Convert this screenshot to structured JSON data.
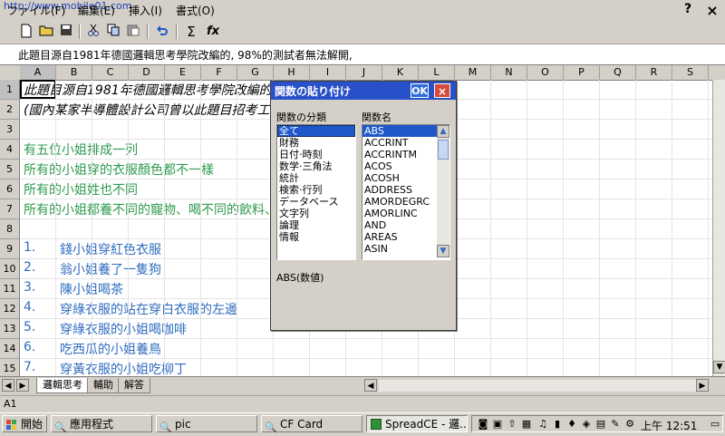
{
  "menubar": {
    "watermark": "http://www.mobile01.com",
    "items": [
      "ファイル(F)",
      "編集(E)",
      "挿入(I)",
      "書式(O)"
    ],
    "help": "?",
    "close": "×"
  },
  "toolbar": {
    "buttons": [
      "new-doc-icon",
      "open-folder-icon",
      "save-icon",
      "cut-icon",
      "copy-icon",
      "paste-icon",
      "undo-icon",
      "sum-icon",
      "function-icon"
    ],
    "sum_label": "Σ",
    "fx_label": "fx"
  },
  "formula_bar": {
    "text": "此題目源自1981年德國邏輯思考學院改編的, 98%的測試者無法解開,"
  },
  "columns": [
    "A",
    "B",
    "C",
    "D",
    "E",
    "F",
    "G",
    "H",
    "I",
    "J",
    "K",
    "L",
    "M",
    "N",
    "O",
    "P",
    "Q",
    "R",
    "S"
  ],
  "rows": [
    "1",
    "2",
    "3",
    "4",
    "5",
    "6",
    "7",
    "8",
    "9",
    "10",
    "11",
    "12",
    "13",
    "14",
    "15"
  ],
  "cells": {
    "r1": "此題目源自1981年德國邏輯思考學院改編的, 98%的測試者無法解開,",
    "r2": "(國內某家半導體設計公司曾以此題目招考工程師",
    "r4": "有五位小姐排成一列",
    "r5": "所有的小姐穿的衣服顏色都不一樣",
    "r6": "所有的小姐姓也不同",
    "r7": "所有的小姐都養不同的寵物、喝不同的飲料、吃不同的水果",
    "r9_num": "1.",
    "r9": "錢小姐穿紅色衣服",
    "r10_num": "2.",
    "r10": "翁小姐養了一隻狗",
    "r11_num": "3.",
    "r11": "陳小姐喝茶",
    "r12_num": "4.",
    "r12": "穿綠衣服的站在穿白衣服的左邊",
    "r13_num": "5.",
    "r13": "穿綠衣服的小姐喝咖啡",
    "r14_num": "6.",
    "r14": "吃西瓜的小姐養鳥",
    "r15_num": "7.",
    "r15": "穿黃衣服的小姐吃柳丁"
  },
  "sheet_tabs": [
    "邏輯思考",
    "輔助",
    "解答"
  ],
  "status": {
    "cell_ref": "A1"
  },
  "dialog": {
    "title": "関数の貼り付け",
    "ok": "OK",
    "close": "×",
    "category_label": "関数の分類",
    "name_label": "関数名",
    "categories": [
      "全て",
      "財務",
      "日付·時刻",
      "数学·三角法",
      "統計",
      "検索·行列",
      "データベース",
      "文字列",
      "論理",
      "情報"
    ],
    "functions": [
      "ABS",
      "ACCRINT",
      "ACCRINTM",
      "ACOS",
      "ACOSH",
      "ADDRESS",
      "AMORDEGRC",
      "AMORLINC",
      "AND",
      "AREAS",
      "ASIN"
    ],
    "selected_category": "全て",
    "selected_function": "ABS",
    "description": "ABS(数値)"
  },
  "taskbar": {
    "start": "開始",
    "buttons": [
      "應用程式",
      "pic",
      "CF Card",
      "SpreadCE - 邏..."
    ],
    "clock": "上午 12:51"
  },
  "colors": {
    "title_blue": "#2850c8",
    "text_green": "#2e9b4e",
    "text_blue": "#2f6cbf",
    "selection": "#1f58c9"
  }
}
